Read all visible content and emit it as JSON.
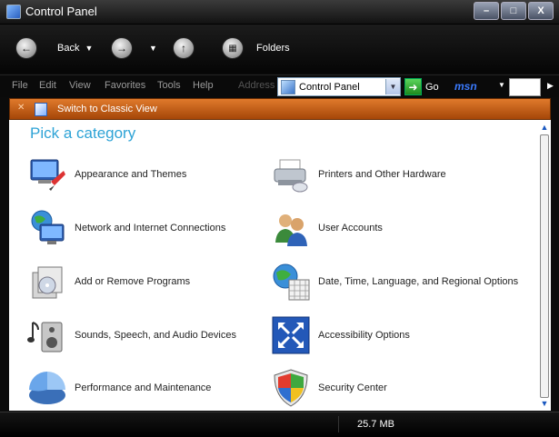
{
  "window": {
    "title": "Control Panel",
    "buttons": {
      "minimize": "–",
      "maximize": "□",
      "close": "X"
    }
  },
  "nav": {
    "back_label": "Back",
    "folders_label": "Folders"
  },
  "menu": {
    "items": [
      "File",
      "Edit",
      "View",
      "Favorites",
      "Tools",
      "Help"
    ],
    "address_label": "Address",
    "address_value": "Control Panel",
    "go_label": "Go",
    "msn_label": "msn"
  },
  "task_pane": {
    "switch_label": "Switch to Classic View"
  },
  "content": {
    "heading": "Pick a category",
    "categories": [
      {
        "label": "Appearance and Themes",
        "icon": "appearance-themes-icon"
      },
      {
        "label": "Printers and Other Hardware",
        "icon": "printer-icon"
      },
      {
        "label": "Network and Internet Connections",
        "icon": "network-globe-icon"
      },
      {
        "label": "User Accounts",
        "icon": "users-icon"
      },
      {
        "label": "Add or Remove Programs",
        "icon": "add-remove-programs-icon"
      },
      {
        "label": "Date, Time, Language, and Regional Options",
        "icon": "globe-calendar-icon"
      },
      {
        "label": "Sounds, Speech, and Audio Devices",
        "icon": "speaker-icon"
      },
      {
        "label": "Accessibility Options",
        "icon": "accessibility-icon"
      },
      {
        "label": "Performance and Maintenance",
        "icon": "performance-chart-icon"
      },
      {
        "label": "Security Center",
        "icon": "security-shield-icon"
      }
    ]
  },
  "status": {
    "size": "25.7 MB"
  },
  "colors": {
    "heading": "#2ea3d6",
    "task_pane": "#c85e1a",
    "chrome": "#0b0b0b"
  }
}
